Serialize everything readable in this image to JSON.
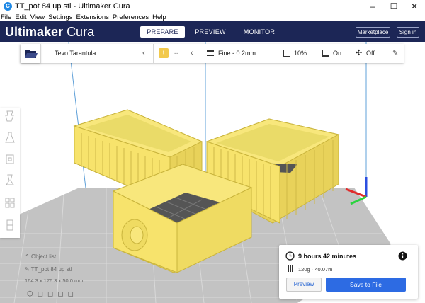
{
  "window": {
    "title": "TT_pot 84 up stl - Ultimaker Cura",
    "controls": [
      "–",
      "☐",
      "✕"
    ]
  },
  "menu": [
    "File",
    "Edit",
    "View",
    "Settings",
    "Extensions",
    "Preferences",
    "Help"
  ],
  "header": {
    "brand_bold": "Ultimaker",
    "brand_light": "Cura",
    "tabs": [
      "PREPARE",
      "PREVIEW",
      "MONITOR"
    ],
    "active_tab": "PREPARE",
    "marketplace": "Marketplace",
    "signin": "Sign in"
  },
  "toolbar": {
    "printer": "Tevo Tarantula",
    "material_dash": "--",
    "profile": "Fine - 0.2mm",
    "infill": "10%",
    "support": "On",
    "adhesion": "Off"
  },
  "object_list": {
    "label": "Object list",
    "item": "TT_pot 84 up stl",
    "dims": "164.3 x 176.3 x 50.0 mm"
  },
  "print_panel": {
    "time": "9 hours 42 minutes",
    "usage": "120g · 40.07m",
    "preview_button": "Preview",
    "save_button": "Save to File"
  },
  "colors": {
    "header_bg": "#1c2656",
    "accent": "#2d6be3",
    "model": "#f7e36c",
    "plate": "#bdbdbd"
  }
}
